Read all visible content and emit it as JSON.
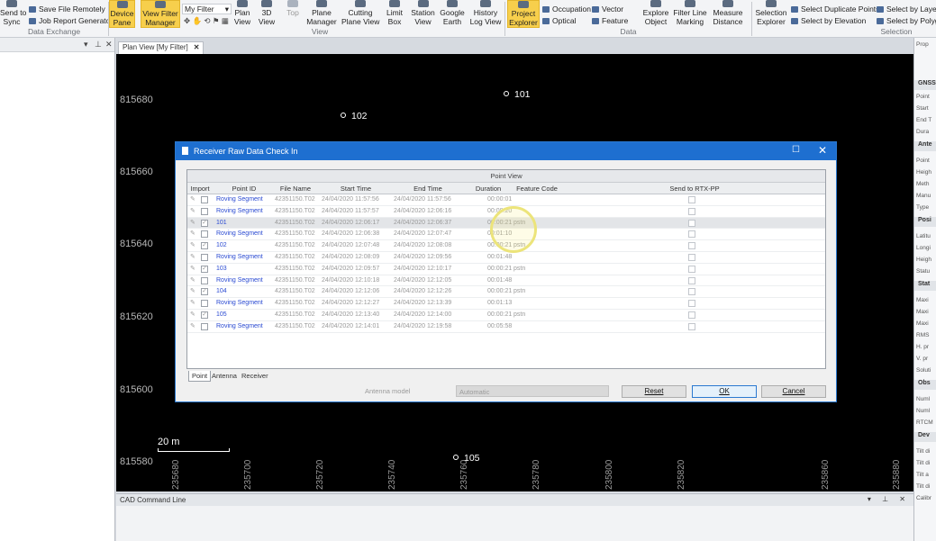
{
  "ribbon": {
    "data_exchange": {
      "label": "Data Exchange",
      "send_to_sync": "Send to\nSync",
      "save_file_remotely": "Save File Remotely",
      "job_report_generator": "Job Report Generator"
    },
    "device_pane": "Device\nPane",
    "view_filter_manager": "View Filter\nManager",
    "filter_select": "My Filter",
    "view": {
      "label": "View",
      "plan_view": "Plan\nView",
      "view_3d": "3D\nView",
      "top": "Top",
      "plane_manager": "Plane\nManager",
      "cutting_plane_view": "Cutting\nPlane View",
      "limit_box": "Limit\nBox",
      "station_view": "Station\nView",
      "google_earth": "Google\nEarth",
      "history_log_view": "History\nLog View"
    },
    "data": {
      "label": "Data",
      "project_explorer": "Project\nExplorer",
      "occupation": "Occupation",
      "optical": "Optical",
      "vector": "Vector",
      "feature": "Feature",
      "explore_object": "Explore\nObject",
      "filter_line_marking": "Filter Line\nMarking",
      "measure_distance": "Measure\nDistance"
    },
    "selection": {
      "label": "Selection",
      "selection_explorer": "Selection\nExplorer",
      "select_duplicate_points": "Select Duplicate Points",
      "select_by_elevation": "Select by Elevation",
      "select_by_layer": "Select by Layer",
      "select_by_polygon": "Select by Polyg"
    }
  },
  "tabs": {
    "plan_view": "Plan View [My Filter]"
  },
  "plan": {
    "y_labels": [
      "815680",
      "815660",
      "815640",
      "815620",
      "815600",
      "815580"
    ],
    "x_labels": [
      "235680",
      "235700",
      "235720",
      "235740",
      "235760",
      "235780",
      "235800",
      "235820",
      "235860",
      "235880"
    ],
    "points": [
      "101",
      "102",
      "105"
    ],
    "scale_label": "20 m"
  },
  "command_line": {
    "title": "CAD Command Line"
  },
  "right_panel": {
    "tab": "Prop",
    "sections": [
      "GNSS",
      "Ante",
      "Posi",
      "Stat",
      "Obs",
      "Dev"
    ],
    "rows": [
      "Point",
      "Start",
      "End T",
      "Dura",
      "Point",
      "Heigh",
      "Meth",
      "Manu",
      "Type",
      "Latitu",
      "Longi",
      "Heigh",
      "Statu",
      "Maxi",
      "Maxi",
      "Maxi",
      "RMS",
      "H. pr",
      "V. pr",
      "Soluti",
      "Numl",
      "Numl",
      "RTCM",
      "Tilt di",
      "Tilt di",
      "Tilt a",
      "Tilt di",
      "Calibr"
    ]
  },
  "dialog": {
    "title": "Receiver Raw Data Check In",
    "grid_title": "Point View",
    "columns": [
      "Import",
      "Point ID",
      "File Name",
      "Start Time",
      "End Time",
      "Duration",
      "Feature Code",
      "Send to RTX-PP"
    ],
    "rows": [
      {
        "checked": false,
        "point_id": "Roving Segment",
        "file": "42351150.T02",
        "start": "24/04/2020 11:57:56",
        "end": "24/04/2020 11:57:56",
        "duration": "00:00:01",
        "code": "",
        "is_point": false
      },
      {
        "checked": false,
        "point_id": "Roving Segment",
        "file": "42351150.T02",
        "start": "24/04/2020 11:57:57",
        "end": "24/04/2020 12:06:16",
        "duration": "00:08:20",
        "code": "",
        "is_point": false
      },
      {
        "checked": true,
        "point_id": "101",
        "file": "42351150.T02",
        "start": "24/04/2020 12:06:17",
        "end": "24/04/2020 12:06:37",
        "duration": "00:00:21",
        "code": "pstn",
        "is_point": true
      },
      {
        "checked": false,
        "point_id": "Roving Segment",
        "file": "42351150.T02",
        "start": "24/04/2020 12:06:38",
        "end": "24/04/2020 12:07:47",
        "duration": "00:01:10",
        "code": "",
        "is_point": false
      },
      {
        "checked": true,
        "point_id": "102",
        "file": "42351150.T02",
        "start": "24/04/2020 12:07:48",
        "end": "24/04/2020 12:08:08",
        "duration": "00:00:21",
        "code": "pstn",
        "is_point": true
      },
      {
        "checked": false,
        "point_id": "Roving Segment",
        "file": "42351150.T02",
        "start": "24/04/2020 12:08:09",
        "end": "24/04/2020 12:09:56",
        "duration": "00:01:48",
        "code": "",
        "is_point": false
      },
      {
        "checked": true,
        "point_id": "103",
        "file": "42351150.T02",
        "start": "24/04/2020 12:09:57",
        "end": "24/04/2020 12:10:17",
        "duration": "00:00:21",
        "code": "pstn",
        "is_point": true
      },
      {
        "checked": false,
        "point_id": "Roving Segment",
        "file": "42351150.T02",
        "start": "24/04/2020 12:10:18",
        "end": "24/04/2020 12:12:05",
        "duration": "00:01:48",
        "code": "",
        "is_point": false
      },
      {
        "checked": true,
        "point_id": "104",
        "file": "42351150.T02",
        "start": "24/04/2020 12:12:06",
        "end": "24/04/2020 12:12:26",
        "duration": "00:00:21",
        "code": "pstn",
        "is_point": true
      },
      {
        "checked": false,
        "point_id": "Roving Segment",
        "file": "42351150.T02",
        "start": "24/04/2020 12:12:27",
        "end": "24/04/2020 12:13:39",
        "duration": "00:01:13",
        "code": "",
        "is_point": false
      },
      {
        "checked": true,
        "point_id": "105",
        "file": "42351150.T02",
        "start": "24/04/2020 12:13:40",
        "end": "24/04/2020 12:14:00",
        "duration": "00:00:21",
        "code": "pstn",
        "is_point": true
      },
      {
        "checked": false,
        "point_id": "Roving Segment",
        "file": "42351150.T02",
        "start": "24/04/2020 12:14:01",
        "end": "24/04/2020 12:19:58",
        "duration": "00:05:58",
        "code": "",
        "is_point": false
      }
    ],
    "bottom_tabs": [
      "Point",
      "Antenna",
      "Receiver"
    ],
    "antenna_model_label": "Antenna model",
    "antenna_model_value": "Automatic",
    "reset": "Reset",
    "ok": "OK",
    "cancel": "Cancel"
  },
  "colors": {
    "accent": "#1e6fd0",
    "highlight": "#f7cf4c",
    "link": "#2a4ad2"
  }
}
